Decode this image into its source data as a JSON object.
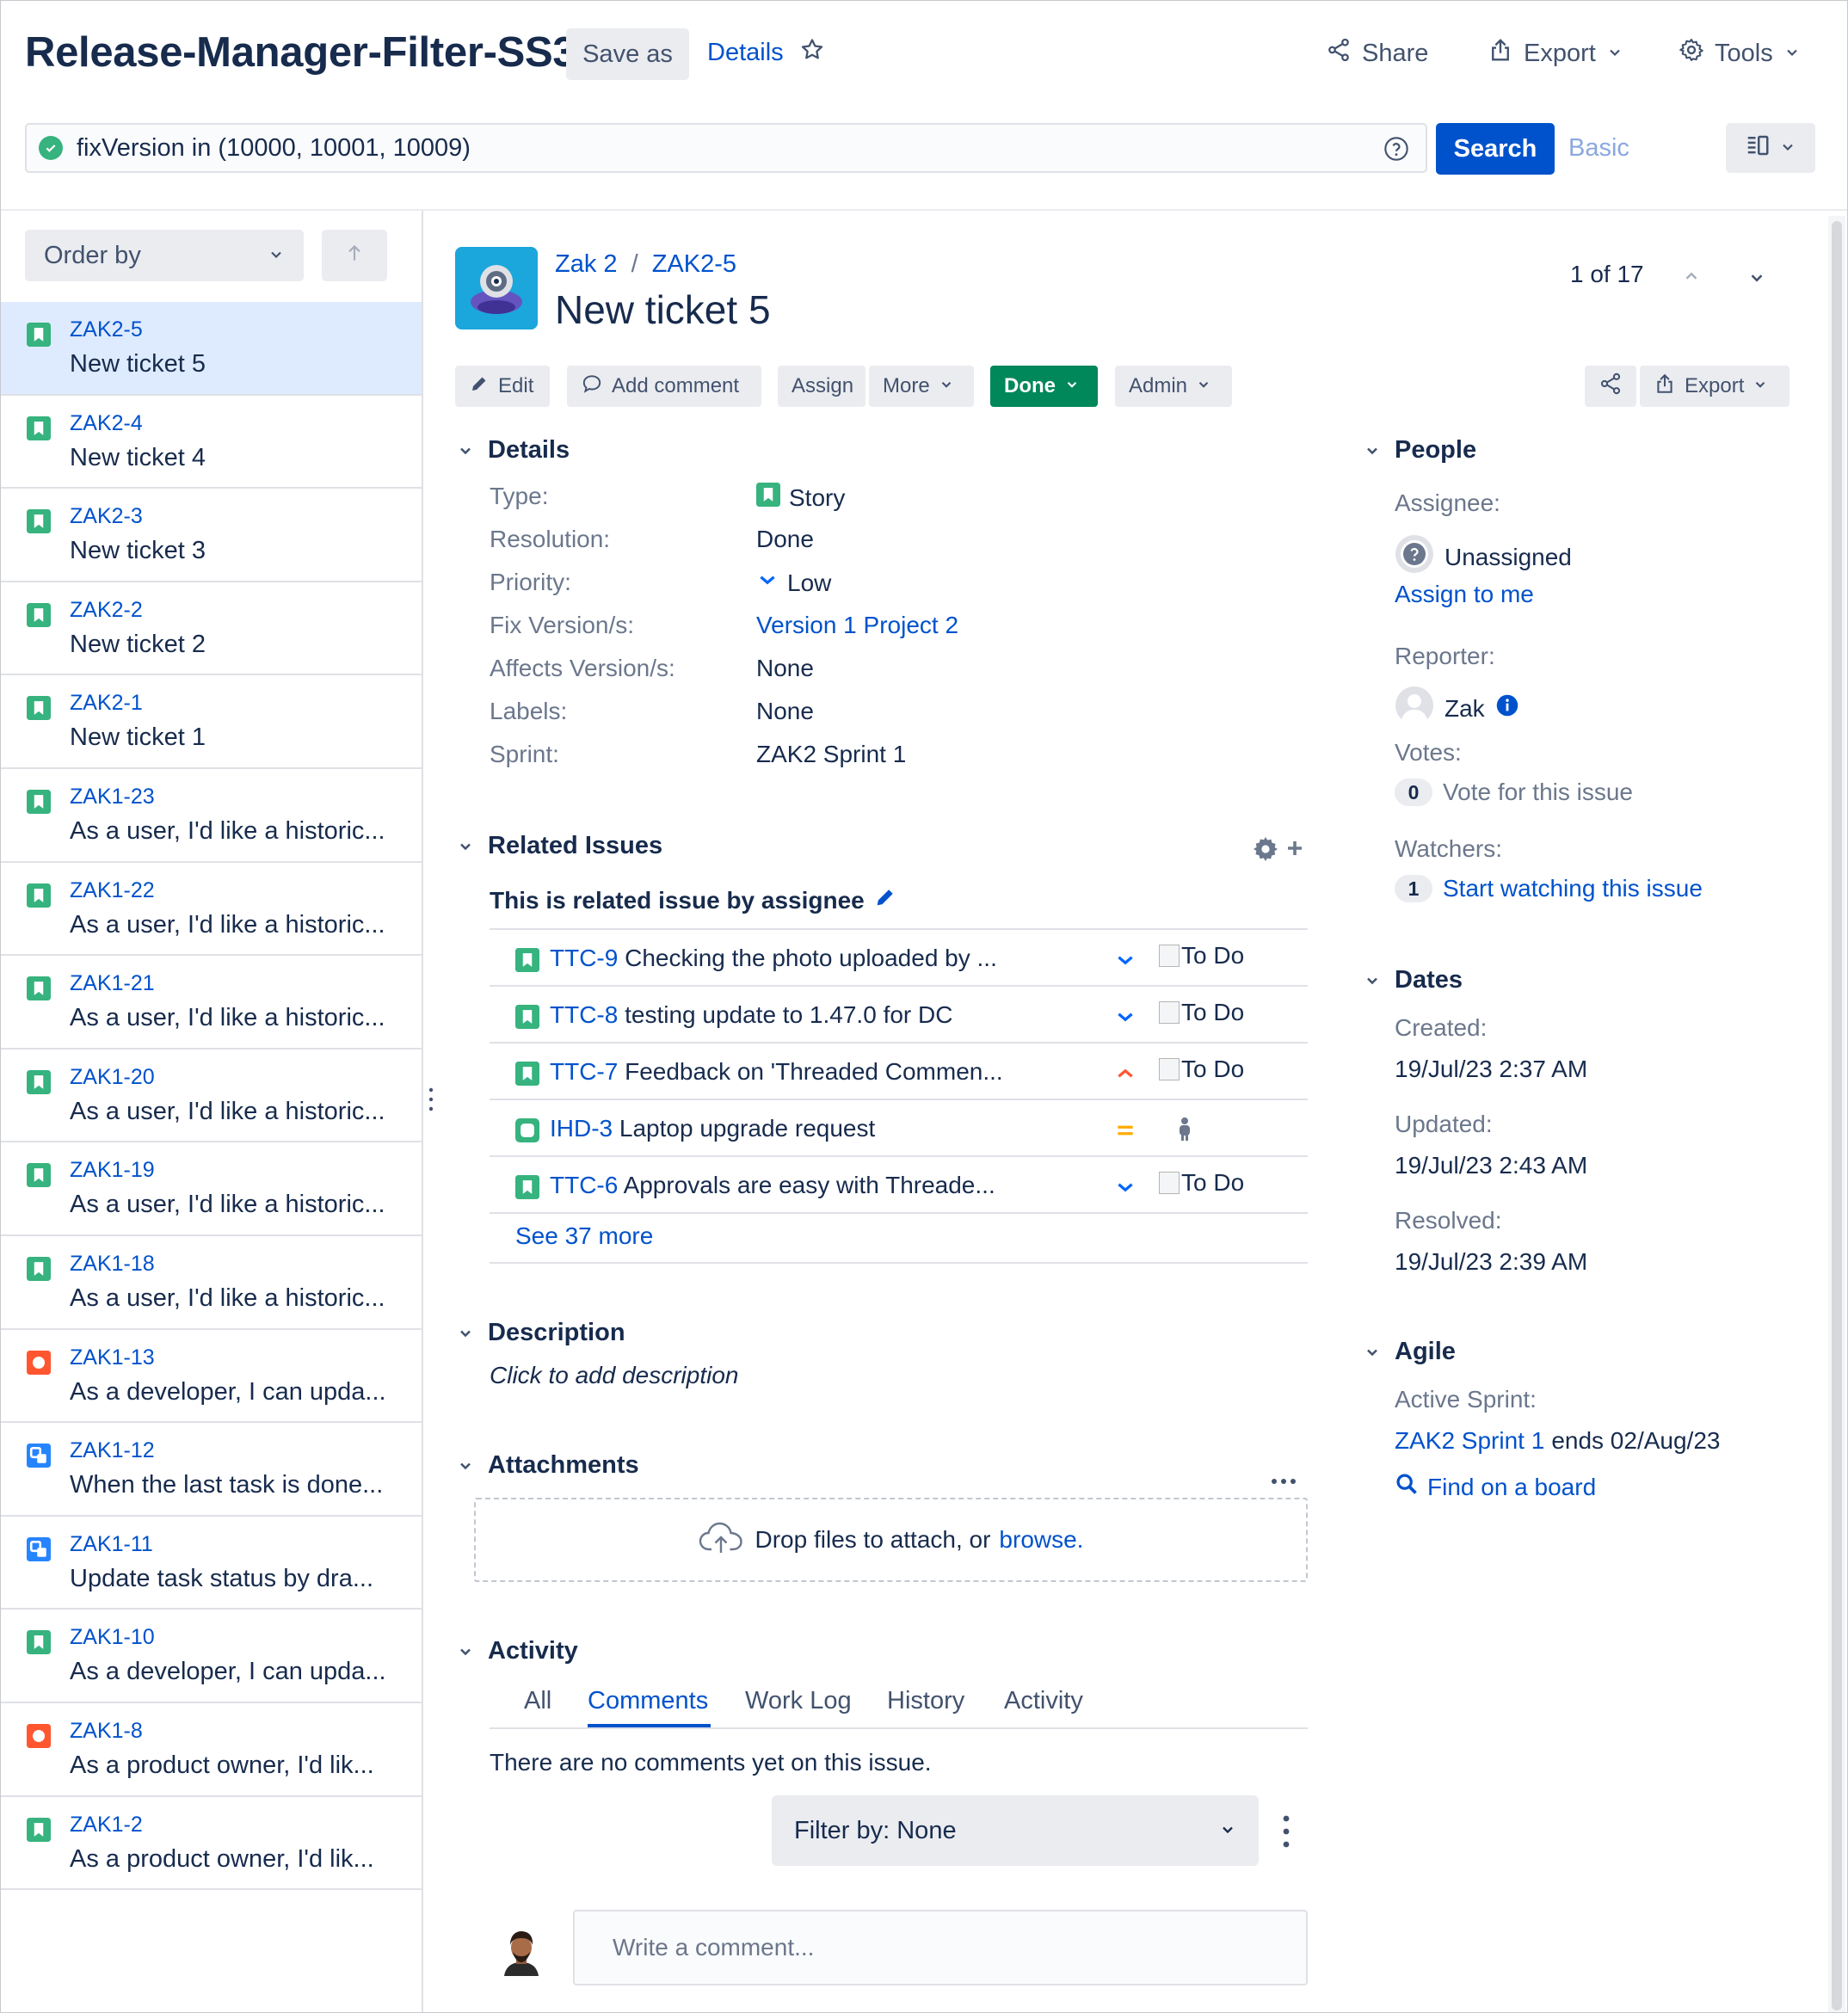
{
  "header": {
    "title": "Release-Manager-Filter-SS3",
    "save_as": "Save as",
    "details": "Details",
    "share": "Share",
    "export": "Export",
    "tools": "Tools"
  },
  "search": {
    "query": "fixVersion in (10000, 10001, 10009)",
    "search_button": "Search",
    "basic": "Basic"
  },
  "list": {
    "order_by": "Order by",
    "items": [
      {
        "key": "ZAK2-5",
        "summary": "New ticket 5",
        "type": "story",
        "selected": true
      },
      {
        "key": "ZAK2-4",
        "summary": "New ticket 4",
        "type": "story"
      },
      {
        "key": "ZAK2-3",
        "summary": "New ticket 3",
        "type": "story"
      },
      {
        "key": "ZAK2-2",
        "summary": "New ticket 2",
        "type": "story"
      },
      {
        "key": "ZAK2-1",
        "summary": "New ticket 1",
        "type": "story"
      },
      {
        "key": "ZAK1-23",
        "summary": "As a user, I'd like a historic...",
        "type": "story"
      },
      {
        "key": "ZAK1-22",
        "summary": "As a user, I'd like a historic...",
        "type": "story"
      },
      {
        "key": "ZAK1-21",
        "summary": "As a user, I'd like a historic...",
        "type": "story"
      },
      {
        "key": "ZAK1-20",
        "summary": "As a user, I'd like a historic...",
        "type": "story"
      },
      {
        "key": "ZAK1-19",
        "summary": "As a user, I'd like a historic...",
        "type": "story"
      },
      {
        "key": "ZAK1-18",
        "summary": "As a user, I'd like a historic...",
        "type": "story"
      },
      {
        "key": "ZAK1-13",
        "summary": "As a developer, I can upda...",
        "type": "bug"
      },
      {
        "key": "ZAK1-12",
        "summary": "When the last task is done...",
        "type": "subtask"
      },
      {
        "key": "ZAK1-11",
        "summary": "Update task status by dra...",
        "type": "subtask"
      },
      {
        "key": "ZAK1-10",
        "summary": "As a developer, I can upda...",
        "type": "story"
      },
      {
        "key": "ZAK1-8",
        "summary": "As a product owner, I'd lik...",
        "type": "bug"
      },
      {
        "key": "ZAK1-2",
        "summary": "As a product owner, I'd lik...",
        "type": "story"
      }
    ]
  },
  "issue": {
    "project": "Zak 2",
    "key": "ZAK2-5",
    "title": "New ticket 5",
    "pager": "1 of 17",
    "ops": {
      "edit": "Edit",
      "add_comment": "Add comment",
      "assign": "Assign",
      "more": "More",
      "done": "Done",
      "admin": "Admin",
      "export": "Export"
    },
    "details": {
      "heading": "Details",
      "fields": [
        {
          "label": "Type:",
          "value": "Story"
        },
        {
          "label": "Resolution:",
          "value": "Done"
        },
        {
          "label": "Priority:",
          "value": "Low"
        },
        {
          "label": "Fix Version/s:",
          "value": "Version 1 Project 2"
        },
        {
          "label": "Affects Version/s:",
          "value": "None"
        },
        {
          "label": "Labels:",
          "value": "None"
        },
        {
          "label": "Sprint:",
          "value": "ZAK2 Sprint 1"
        }
      ]
    },
    "related": {
      "heading": "Related Issues",
      "subheading": "This is related issue by assignee",
      "items": [
        {
          "key": "TTC-9",
          "summary": "Checking the photo uploaded by ...",
          "priority": "low",
          "status": "To Do",
          "type": "story"
        },
        {
          "key": "TTC-8",
          "summary": "testing update to 1.47.0 for DC",
          "priority": "low",
          "status": "To Do",
          "type": "story"
        },
        {
          "key": "TTC-7",
          "summary": "Feedback on 'Threaded Commen...",
          "priority": "high",
          "status": "To Do",
          "type": "story"
        },
        {
          "key": "IHD-3",
          "summary": "Laptop upgrade request",
          "priority": "medium",
          "status": "",
          "type": "service"
        },
        {
          "key": "TTC-6",
          "summary": "Approvals are easy with Threade...",
          "priority": "low",
          "status": "To Do",
          "type": "story"
        }
      ],
      "see_more": "See 37 more"
    },
    "description": {
      "heading": "Description",
      "placeholder": "Click to add description"
    },
    "attachments": {
      "heading": "Attachments",
      "drop_text": "Drop files to attach, or",
      "browse": "browse."
    },
    "activity": {
      "heading": "Activity",
      "tabs": [
        "All",
        "Comments",
        "Work Log",
        "History",
        "Activity"
      ],
      "active_tab": "Comments",
      "empty": "There are no comments yet on this issue.",
      "filter": "Filter by: None",
      "comment_placeholder": "Write a comment..."
    }
  },
  "people": {
    "heading": "People",
    "assignee_label": "Assignee:",
    "assignee": "Unassigned",
    "assign_to_me": "Assign to me",
    "reporter_label": "Reporter:",
    "reporter": "Zak",
    "votes_label": "Votes:",
    "votes_count": "0",
    "vote_text": "Vote for this issue",
    "watchers_label": "Watchers:",
    "watchers_count": "1",
    "watch_text": "Start watching this issue"
  },
  "dates": {
    "heading": "Dates",
    "created_label": "Created:",
    "created": "19/Jul/23 2:37 AM",
    "updated_label": "Updated:",
    "updated": "19/Jul/23 2:43 AM",
    "resolved_label": "Resolved:",
    "resolved": "19/Jul/23 2:39 AM"
  },
  "agile": {
    "heading": "Agile",
    "active_sprint_label": "Active Sprint:",
    "sprint": "ZAK2 Sprint 1",
    "sprint_ends": "ends 02/Aug/23",
    "find_board": "Find on a board"
  },
  "colors": {
    "primary": "#0052cc",
    "story": "#36b37e",
    "bug": "#ff5630",
    "subtask": "#2684ff",
    "done": "#00875a",
    "selected_row": "#deebff"
  }
}
